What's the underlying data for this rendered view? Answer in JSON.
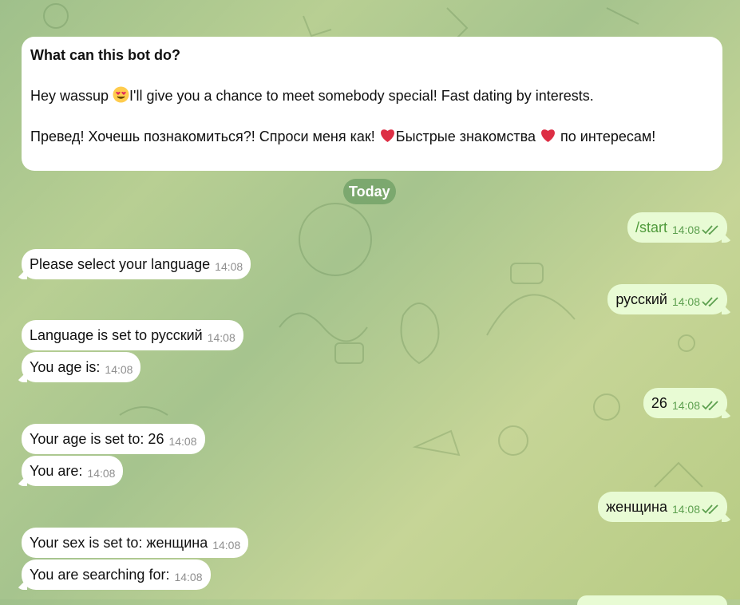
{
  "intro": {
    "title": "What can this bot do?",
    "line1_before": "Hey wassup ",
    "line1_after": "I'll give you a chance to meet somebody special! Fast dating by interests.",
    "line2_part1": "Превед! Хочешь познакомиться?! Спроси меня как! ",
    "line2_part2": "Быстрые знакомства ",
    "line2_part3": " по интересам!"
  },
  "date_label": "Today",
  "messages": [
    {
      "side": "outgoing",
      "text": "/start",
      "time": "14:08"
    },
    {
      "side": "incoming",
      "text": "Please select your language",
      "time": "14:08"
    },
    {
      "side": "outgoing",
      "text": "русский",
      "time": "14:08"
    },
    {
      "side": "incoming",
      "text": "Language is set to русский",
      "time": "14:08"
    },
    {
      "side": "incoming",
      "text": "You age is:",
      "time": "14:08"
    },
    {
      "side": "outgoing",
      "text": "26",
      "time": "14:08"
    },
    {
      "side": "incoming",
      "text": "Your age is set to: 26",
      "time": "14:08"
    },
    {
      "side": "incoming",
      "text": "You are:",
      "time": "14:08"
    },
    {
      "side": "outgoing",
      "text": "женщина",
      "time": "14:08"
    },
    {
      "side": "incoming",
      "text": "Your sex is set to: женщина",
      "time": "14:08"
    },
    {
      "side": "incoming",
      "text": "You are searching for:",
      "time": "14:08"
    }
  ],
  "colors": {
    "incoming_bubble": "#ffffff",
    "outgoing_bubble": "#e8fbd4",
    "outgoing_meta": "#5da04f"
  },
  "icons": [
    "heart-eyes-emoji-icon",
    "red-heart-icon",
    "double-check-icon"
  ]
}
